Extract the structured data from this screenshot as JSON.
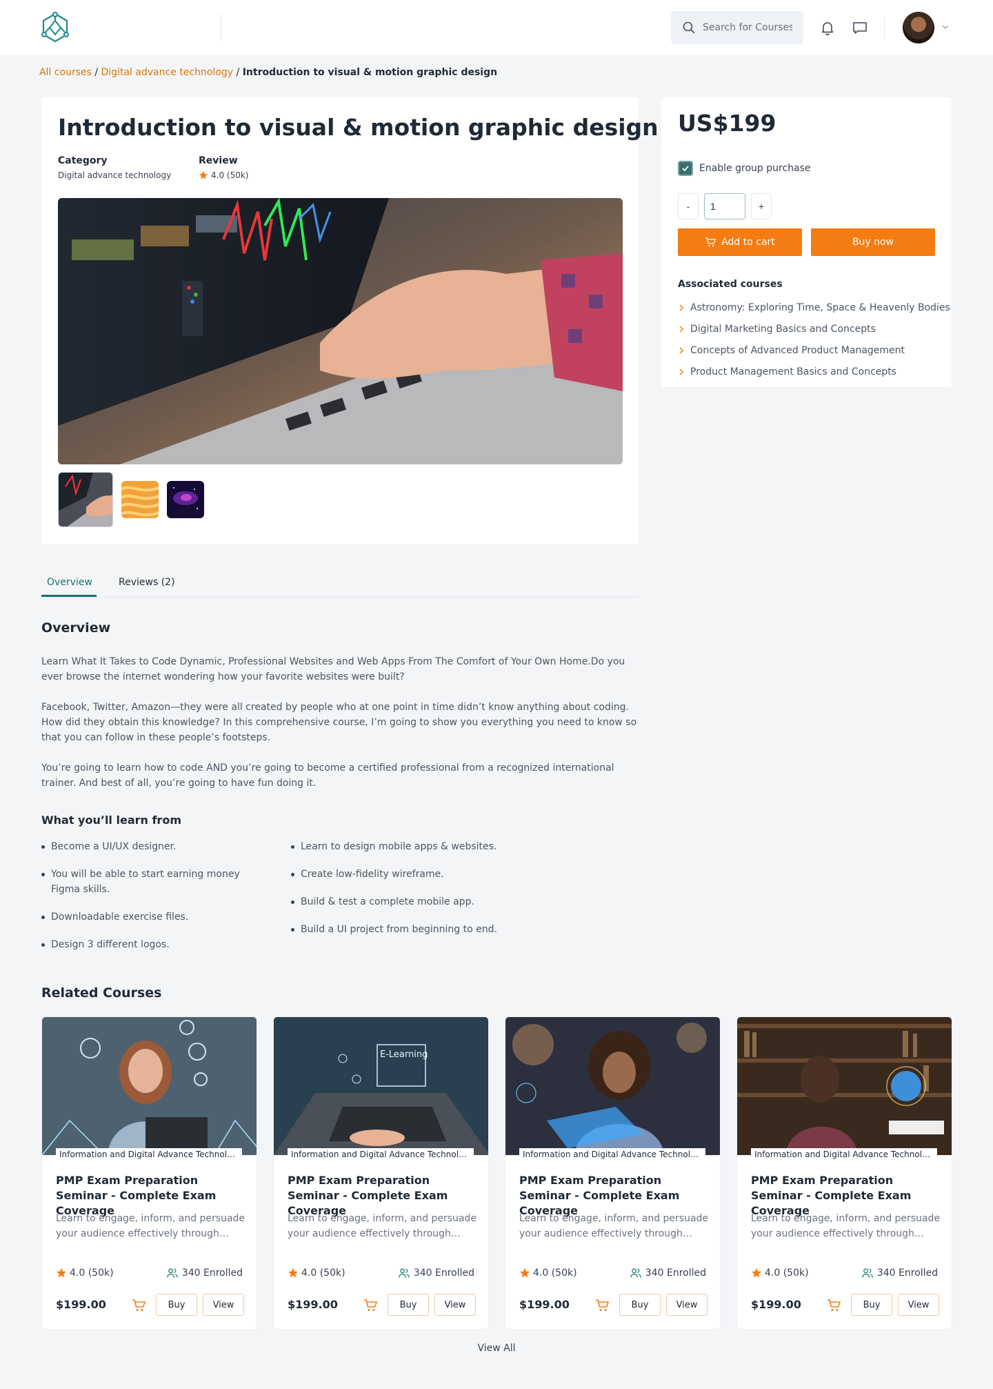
{
  "header": {
    "search_placeholder": "Search for Courses",
    "logo_icon": "hexagon-network-icon",
    "icons": [
      "search-icon",
      "bell-icon",
      "chat-icon",
      "chevron-down-icon"
    ]
  },
  "breadcrumb": {
    "items": [
      "All courses",
      "Digital advance technology"
    ],
    "current": "Introduction to visual & motion graphic design",
    "separator": "/"
  },
  "course": {
    "title": "Introduction to visual & motion graphic design",
    "category_label": "Category",
    "category_value": "Digital advance technology",
    "review_label": "Review",
    "review_value": "4.0 (50k)"
  },
  "tabs": [
    {
      "label": "Overview",
      "active": true
    },
    {
      "label": "Reviews (2)",
      "active": false
    }
  ],
  "overview": {
    "heading": "Overview",
    "paragraphs": [
      "Learn What It Takes to Code Dynamic, Professional Websites and Web Apps From The Comfort of Your Own Home.Do you ever browse the internet wondering how your favorite websites were built?",
      "Facebook, Twitter, Amazon—they were all created by people who at one point in time didn’t know anything about coding. How did they obtain this knowledge? In this comprehensive course, I’m going to show you everything you need to know so that you can follow in these people’s footsteps.",
      "You’re going to learn how to code AND you’re going to become a certified professional from a recognized international trainer. And best of all, you’re going to have fun doing it."
    ]
  },
  "learn": {
    "heading": "What you’ll learn from",
    "col1": [
      "Become a UI/UX designer.",
      "You will be able to start earning money Figma skills.",
      "Downloadable exercise files.",
      "Design 3 different logos."
    ],
    "col2": [
      "Learn to design mobile apps & websites.",
      "Create low-fidelity wireframe.",
      "Build & test a complete mobile app.",
      "Build a UI project from beginning to end."
    ]
  },
  "purchase": {
    "price": "US$199",
    "group_purchase_label": "Enable group purchase",
    "group_purchase_checked": true,
    "qty_minus": "-",
    "qty_value": "1",
    "qty_plus": "+",
    "add_to_cart": "Add to cart",
    "buy_now": "Buy now",
    "accent_color": "#f57c13"
  },
  "associated": {
    "heading": "Associated courses",
    "items": [
      "Astronomy: Exploring Time, Space & Heavenly Bodies",
      "Digital Marketing Basics and Concepts",
      "Concepts of Advanced Product Management",
      "Product Management Basics and Concepts"
    ]
  },
  "related": {
    "heading": "Related Courses",
    "view_all": "View All",
    "cards": [
      {
        "tag": "Information and Digital Advance Technolo...",
        "title": "PMP Exam Preparation Seminar - Complete Exam Coverage",
        "desc": "Learn to engage, inform, and persuade your audience effectively through dyna...",
        "rating": "4.0 (50k)",
        "enrolled": "340 Enrolled",
        "price": "$199.00",
        "buy": "Buy",
        "view": "View"
      },
      {
        "tag": "Information and Digital Advance Technolo...",
        "title": "PMP Exam Preparation Seminar - Complete Exam Coverage",
        "desc": "Learn to engage, inform, and persuade your audience effectively through dyna...",
        "rating": "4.0 (50k)",
        "enrolled": "340 Enrolled",
        "price": "$199.00",
        "buy": "Buy",
        "view": "View",
        "image_text": "E-Learning"
      },
      {
        "tag": "Information and Digital Advance Technolo...",
        "title": "PMP Exam Preparation Seminar - Complete Exam Coverage",
        "desc": "Learn to engage, inform, and persuade your audience effectively through dyna...",
        "rating": "4.0 (50k)",
        "enrolled": "340 Enrolled",
        "price": "$199.00",
        "buy": "Buy",
        "view": "View"
      },
      {
        "tag": "Information and Digital Advance Technolo...",
        "title": "PMP Exam Preparation Seminar - Complete Exam Coverage",
        "desc": "Learn to engage, inform, and persuade your audience effectively through dyna...",
        "rating": "4.0 (50k)",
        "enrolled": "340 Enrolled",
        "price": "$199.00",
        "buy": "Buy",
        "view": "View"
      }
    ]
  }
}
